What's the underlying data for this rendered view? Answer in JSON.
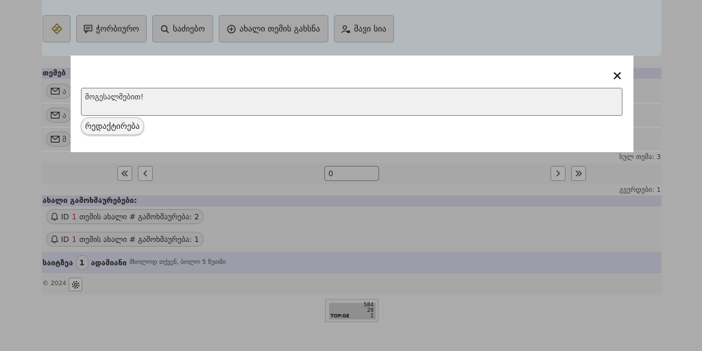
{
  "toolbar": {
    "forum_label": "ჭორბიურო",
    "search_label": "საძიებო",
    "new_topic_label": "ახალი თემის გახსნა",
    "blacklist_label": "შავი სია"
  },
  "topics": {
    "header": "თემებ",
    "rows": [
      {
        "id": "topic-row-1",
        "title": "ა",
        "color": "#8b1d1d"
      },
      {
        "id": "topic-row-2",
        "title": "ა",
        "color": "#8b1d1d"
      },
      {
        "id": "topic-row-3",
        "title": "მ",
        "color": "#2d2d8a"
      }
    ],
    "total": "სულ თემა: 3"
  },
  "pager": {
    "input_value": "0",
    "pages": "გვერდები: 1"
  },
  "new_replies": {
    "header": "ახალი გამოხმაურებები:",
    "items": [
      {
        "prefix": "ID",
        "id": "1",
        "text": "თემის ახალი # გამოხმაურება: 2"
      },
      {
        "prefix": "ID",
        "id": "1",
        "text": "თემის ახალი # გამოხმაურება: 1"
      }
    ]
  },
  "online": {
    "label": "საიტზეა",
    "count": "1",
    "people": "ადამიანი",
    "note": "მხოლოდ თქვენ, ბოლო 5 წუთში"
  },
  "footer": {
    "copyright": "© 2024"
  },
  "counter": {
    "values": [
      "584",
      "29",
      "1"
    ],
    "brand": "TOP.GE"
  },
  "modal": {
    "message": "მოგესალმებით!",
    "edit_label": "რედაქტირება",
    "close_symbol": "✕"
  }
}
